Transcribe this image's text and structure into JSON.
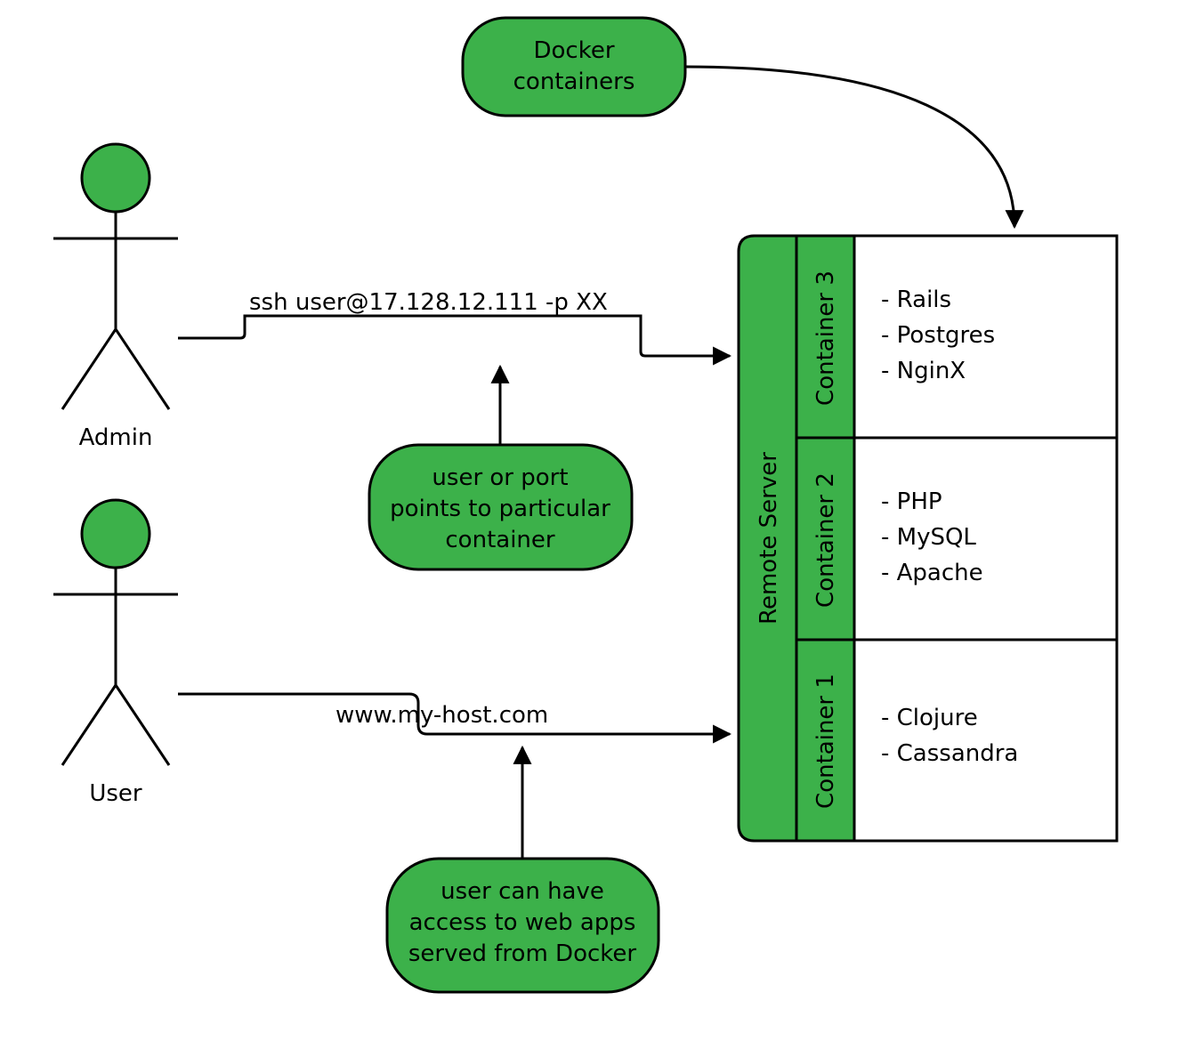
{
  "actors": {
    "admin": {
      "label": "Admin"
    },
    "user": {
      "label": "User"
    }
  },
  "arrows": {
    "ssh": {
      "label": "ssh user@17.128.12.111 -p XX"
    },
    "http": {
      "label": "www.my-host.com"
    }
  },
  "notes": {
    "docker": {
      "line1": "Docker",
      "line2": "containers"
    },
    "port": {
      "line1": "user or port",
      "line2": "points to particular",
      "line3": "container"
    },
    "webapps": {
      "line1": "user can have",
      "line2": "access to web apps",
      "line3": "served from Docker"
    }
  },
  "server": {
    "label": "Remote Server",
    "containers": [
      {
        "label": "Container 3",
        "items": [
          "- Rails",
          "- Postgres",
          "- NginX"
        ]
      },
      {
        "label": "Container 2",
        "items": [
          "- PHP",
          "- MySQL",
          "- Apache"
        ]
      },
      {
        "label": "Container 1",
        "items": [
          "- Clojure",
          "- Cassandra"
        ]
      }
    ]
  }
}
